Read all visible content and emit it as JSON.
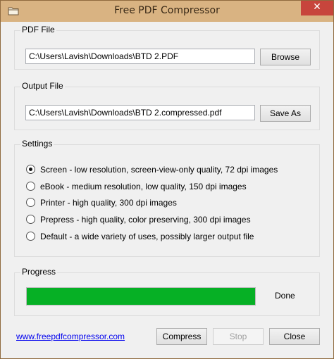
{
  "window": {
    "title": "Free PDF Compressor",
    "close_glyph": "✕",
    "icon": "folder-icon"
  },
  "pdf_file": {
    "label": "PDF File",
    "value": "C:\\Users\\Lavish\\Downloads\\BTD  2.PDF",
    "browse_label": "Browse"
  },
  "output_file": {
    "label": "Output File",
    "value": "C:\\Users\\Lavish\\Downloads\\BTD  2.compressed.pdf",
    "save_as_label": "Save As"
  },
  "settings": {
    "label": "Settings",
    "options": [
      {
        "label": "Screen - low resolution, screen-view-only quality, 72 dpi images",
        "checked": true
      },
      {
        "label": "eBook - medium resolution, low quality, 150 dpi images",
        "checked": false
      },
      {
        "label": "Printer - high quality, 300 dpi images",
        "checked": false
      },
      {
        "label": "Prepress - high quality, color preserving, 300 dpi images",
        "checked": false
      },
      {
        "label": "Default - a wide variety of uses, possibly larger output file",
        "checked": false
      }
    ]
  },
  "progress": {
    "label": "Progress",
    "value": 1.0,
    "status": "Done",
    "color": "#06b025"
  },
  "footer": {
    "link": "www.freepdfcompressor.com",
    "compress_label": "Compress",
    "stop_label": "Stop",
    "close_label": "Close"
  }
}
